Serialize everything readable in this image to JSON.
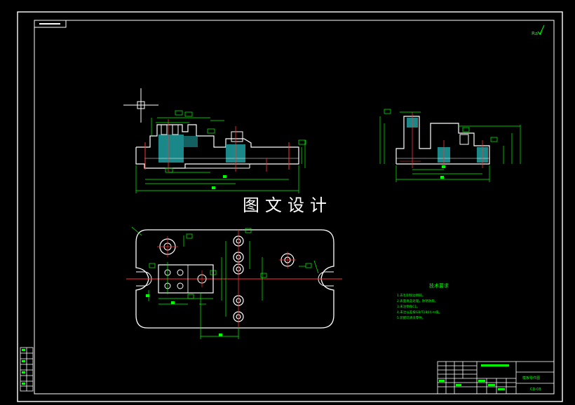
{
  "watermark": "图文设计",
  "colors": {
    "background": "#000000",
    "outline": "#ffffff",
    "dimension": "#00ff00",
    "centerline": "#ff3030",
    "section_fill": "#1fa0a0",
    "crosshair": "#ffffff"
  },
  "tech_requirements": {
    "title": "技术要求",
    "lines": [
      "1.去毛刺锐边倒钝。",
      "2.表面发蓝处理，防锈防腐。",
      "3.未注倒角C1。",
      "4.未注公差按GB/T1804-m级。",
      "5.装配前清洗零件。"
    ]
  },
  "title_block": {
    "drawing_name": "模板零件图",
    "drawing_code": "CD-08"
  },
  "corner_tag": "Ra √"
}
